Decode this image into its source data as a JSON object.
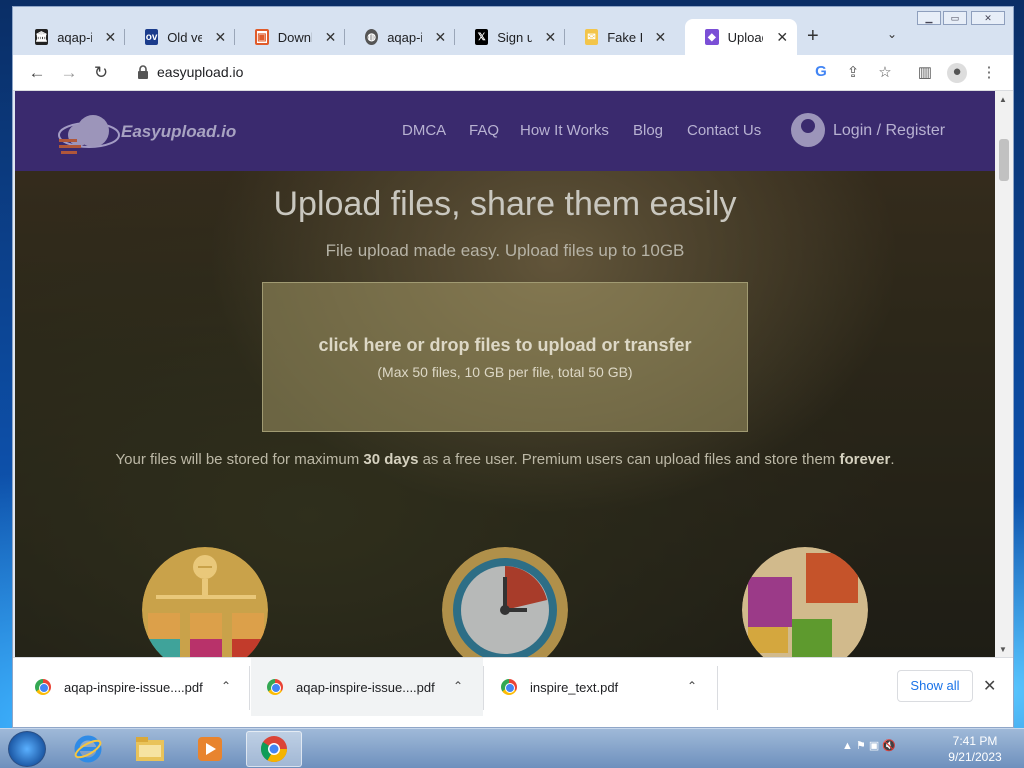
{
  "tabs": [
    {
      "title": "aqap-inspire",
      "icon": "bank-icon"
    },
    {
      "title": "Old versions",
      "icon": "ov-icon"
    },
    {
      "title": "Download",
      "icon": "pdf-icon"
    },
    {
      "title": "aqap-inspire",
      "icon": "globe-icon"
    },
    {
      "title": "Sign up",
      "icon": "x-logo-icon"
    },
    {
      "title": "Fake Email",
      "icon": "envelope-icon"
    },
    {
      "title": "Upload Files",
      "icon": "easyupload-icon",
      "active": true
    }
  ],
  "toolbar": {
    "url": "easyupload.io"
  },
  "site": {
    "brand": "Easyupload.io",
    "nav": [
      "DMCA",
      "FAQ",
      "How It Works",
      "Blog",
      "Contact Us"
    ],
    "login": "Login / Register",
    "hero_title": "Upload files, share them easily",
    "hero_subtitle": "File upload made easy. Upload files up to 10GB",
    "dropzone_main": "click here or drop files to upload or transfer",
    "dropzone_sub": "(Max 50 files, 10 GB per file, total 50 GB)",
    "storage_pre": "Your files will be stored for maximum ",
    "storage_days": "30 days",
    "storage_mid": " as a free user. Premium users can upload files and store them ",
    "storage_forever": "forever",
    "storage_end": "."
  },
  "downloads": {
    "items": [
      "aqap-inspire-issue....pdf",
      "aqap-inspire-issue....pdf",
      "inspire_text.pdf"
    ],
    "show_all": "Show all"
  },
  "taskbar": {
    "time": "7:41 PM",
    "date": "9/21/2023"
  },
  "colors": {
    "site_header": "#3a2a6e",
    "accent_link": "#1a73e8"
  }
}
